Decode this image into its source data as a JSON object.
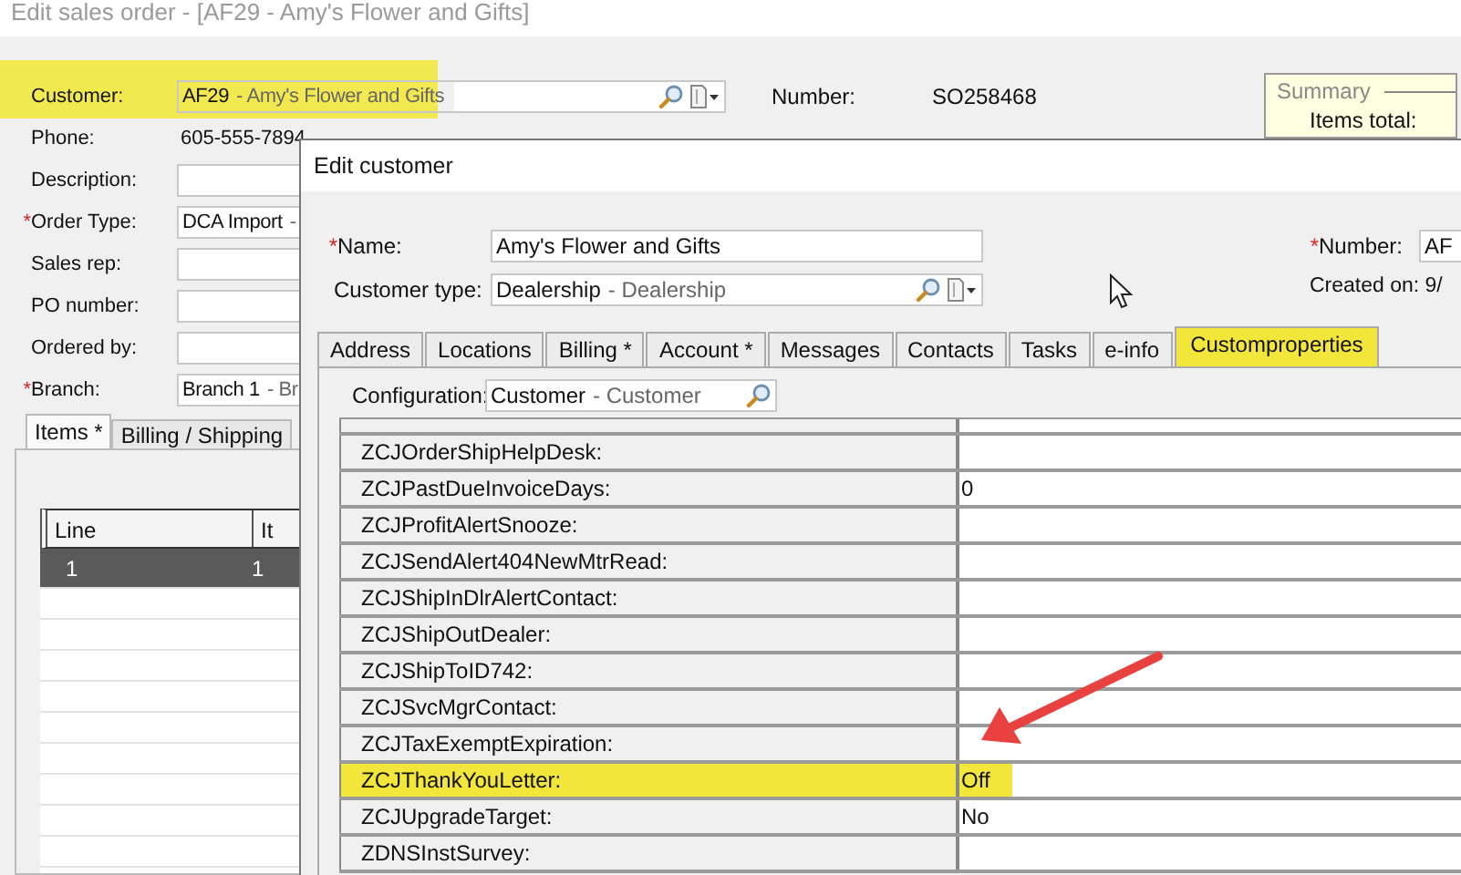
{
  "window": {
    "title": "Edit sales order - [AF29 - Amy's Flower and Gifts]"
  },
  "order_form": {
    "fields": [
      {
        "kind": "lookup",
        "label": "Customer:",
        "code": "AF29",
        "description": "- Amy's Flower and Gifts",
        "highlighted": true
      },
      {
        "kind": "text",
        "label": "Phone:",
        "value": "605-555-7894"
      },
      {
        "kind": "input",
        "label": "Description:"
      },
      {
        "kind": "lookup",
        "required_mark": "*",
        "label": "Order Type:",
        "code": "DCA Import",
        "description": "-"
      },
      {
        "kind": "input",
        "label": "Sales rep:"
      },
      {
        "kind": "input",
        "label": "PO number:"
      },
      {
        "kind": "input",
        "label": "Ordered by:"
      },
      {
        "kind": "lookup",
        "required_mark": "*",
        "label": "Branch:",
        "code": "Branch 1",
        "description": "- Br"
      }
    ],
    "number_label": "Number:",
    "number": "SO258468",
    "summary": {
      "title": "Summary",
      "items_total_label": "Items total:"
    }
  },
  "items_tabs": [
    {
      "label": "Items *",
      "selected": true
    },
    {
      "label": "Billing / Shipping",
      "selected": false
    }
  ],
  "items_grid": {
    "columns": [
      "Line",
      "It"
    ],
    "rows": [
      {
        "cells": [
          "1",
          "1"
        ],
        "selected": true
      }
    ]
  },
  "dialog": {
    "title": "Edit customer",
    "name": {
      "required_mark": "*",
      "label": "Name:",
      "value": "Amy's Flower and Gifts"
    },
    "customer_type": {
      "label": "Customer type:",
      "code": "Dealership",
      "description": "- Dealership"
    },
    "number": {
      "required_mark": "*",
      "label": "Number:",
      "value": "AF"
    },
    "created_on": "Created on: 9/",
    "tabs": [
      {
        "label": "Address",
        "selected": false,
        "highlighted": false
      },
      {
        "label": "Locations",
        "selected": false,
        "highlighted": false
      },
      {
        "label": "Billing *",
        "selected": false,
        "highlighted": false
      },
      {
        "label": "Account *",
        "selected": false,
        "highlighted": false
      },
      {
        "label": "Messages",
        "selected": false,
        "highlighted": false
      },
      {
        "label": "Contacts",
        "selected": false,
        "highlighted": false
      },
      {
        "label": "Tasks",
        "selected": false,
        "highlighted": false
      },
      {
        "label": "e-info",
        "selected": false,
        "highlighted": false
      },
      {
        "label": "Customproperties",
        "selected": true,
        "highlighted": true
      }
    ],
    "configuration": {
      "label": "Configuration:",
      "code": "Customer",
      "description": "- Customer"
    },
    "properties": [
      {
        "name": "ZCJOrderShipHelpDesk:",
        "highlighted": false
      },
      {
        "name": "ZCJPastDueInvoiceDays:",
        "value": "0",
        "highlighted": false
      },
      {
        "name": "ZCJProfitAlertSnooze:",
        "highlighted": false
      },
      {
        "name": "ZCJSendAlert404NewMtrRead:",
        "highlighted": false
      },
      {
        "name": "ZCJShipInDlrAlertContact:",
        "highlighted": false
      },
      {
        "name": "ZCJShipOutDealer:",
        "highlighted": false
      },
      {
        "name": "ZCJShipToID742:",
        "highlighted": false
      },
      {
        "name": "ZCJSvcMgrContact:",
        "highlighted": false
      },
      {
        "name": "ZCJTaxExemptExpiration:",
        "highlighted": false
      },
      {
        "name": "ZCJThankYouLetter:",
        "value": "Off",
        "highlighted": true
      },
      {
        "name": "ZCJUpgradeTarget:",
        "value": "No",
        "highlighted": false
      },
      {
        "name": "ZDNSInstSurvey:",
        "highlighted": false
      }
    ],
    "annotations": [
      {
        "kind": "arrow"
      }
    ]
  }
}
